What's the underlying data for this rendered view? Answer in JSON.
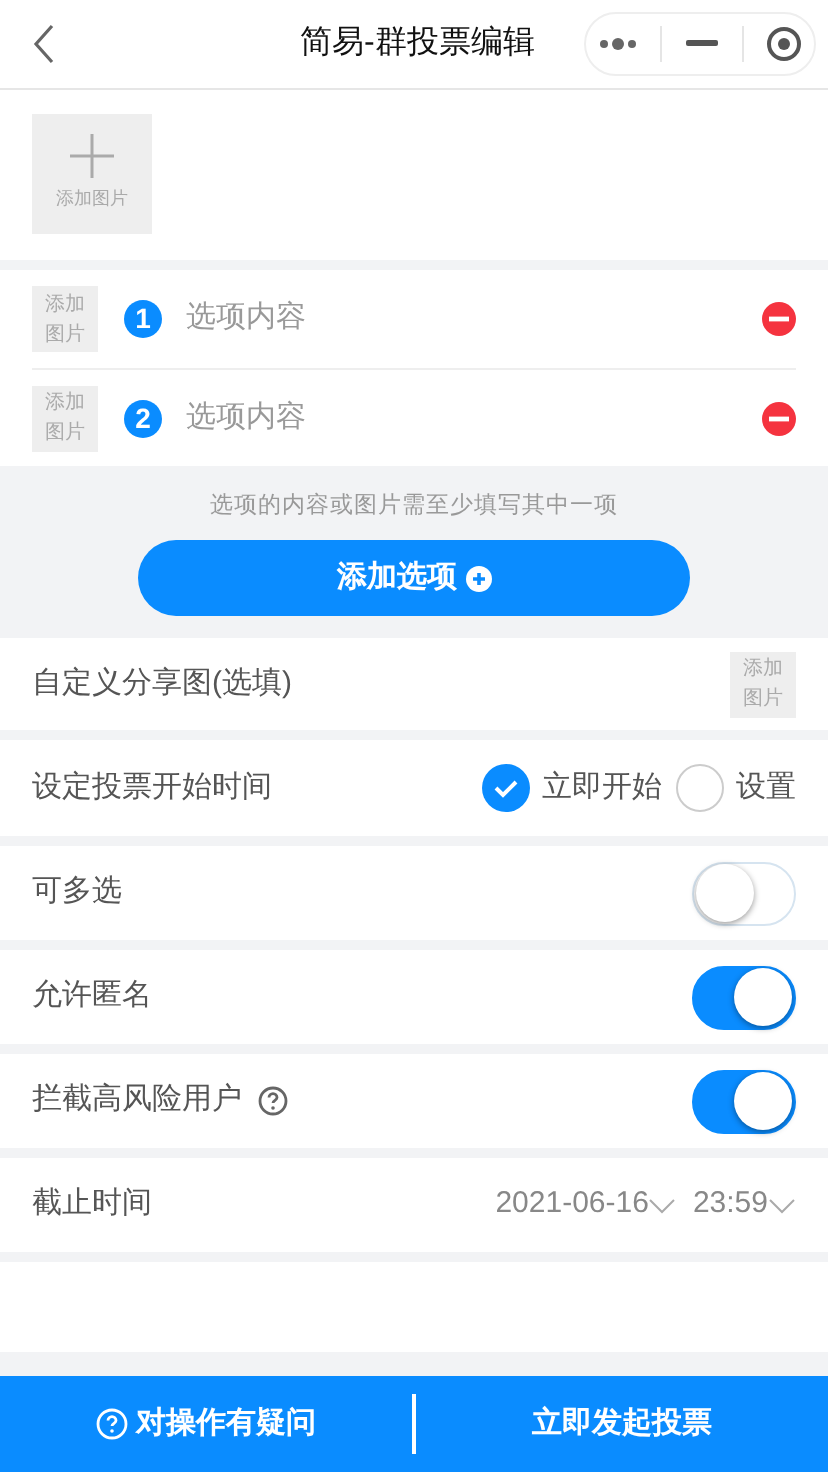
{
  "header": {
    "title": "简易-群投票编辑"
  },
  "cover": {
    "label": "添加图片"
  },
  "options": [
    {
      "number": "1",
      "image_label": "添加图片",
      "placeholder": "选项内容"
    },
    {
      "number": "2",
      "image_label": "添加图片",
      "placeholder": "选项内容"
    }
  ],
  "hint": "选项的内容或图片需至少填写其中一项",
  "add_option_button": "添加选项",
  "share_image": {
    "label": "自定义分享图(选填)",
    "image_label": "添加图片"
  },
  "start_time": {
    "label": "设定投票开始时间",
    "choices": [
      {
        "label": "立即开始",
        "selected": true
      },
      {
        "label": "设置",
        "selected": false
      }
    ]
  },
  "toggles": [
    {
      "label": "可多选",
      "on": false,
      "help": false
    },
    {
      "label": "允许匿名",
      "on": true,
      "help": false
    },
    {
      "label": "拦截高风险用户",
      "on": true,
      "help": true
    }
  ],
  "deadline": {
    "label": "截止时间",
    "date": "2021-06-16",
    "time": "23:59"
  },
  "footer": {
    "help_button": "对操作有疑问",
    "create_button": "立即发起投票"
  }
}
